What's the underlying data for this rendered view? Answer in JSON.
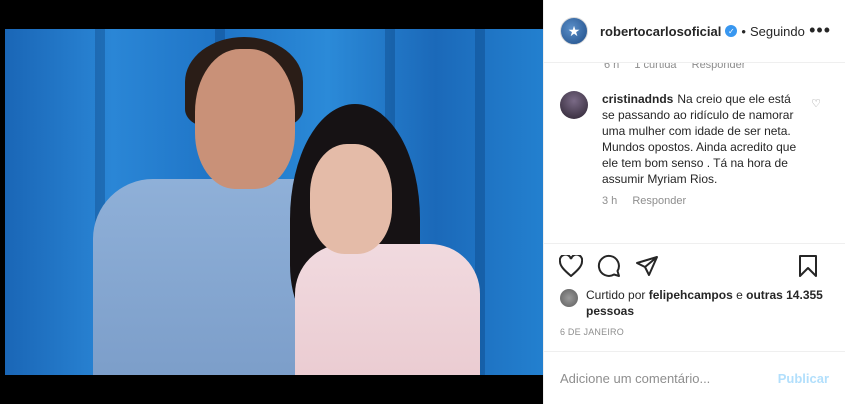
{
  "post": {
    "image_alt": "",
    "username": "robertocarlosoficial",
    "follow_status": "Seguindo",
    "previous_comment_meta": {
      "time": "6 h",
      "likes": "1 curtida",
      "reply": "Responder"
    },
    "comment": {
      "username": "cristinadnds",
      "text": "Na creio que ele está se passando ao ridículo de namorar uma mulher com idade de ser neta. Mundos opostos. Ainda acredito que ele tem bom senso . Tá na hora de assumir Myriam Rios.",
      "time": "3 h",
      "reply": "Responder"
    },
    "likes": {
      "prefix": "Curtido por",
      "user": "felipehcampos",
      "connector": "e",
      "others": "outras 14.355 pessoas"
    },
    "date": "6 DE JANEIRO",
    "add_comment_placeholder": "Adicione um comentário...",
    "publish_label": "Publicar"
  }
}
